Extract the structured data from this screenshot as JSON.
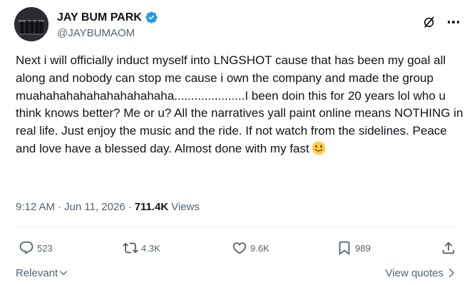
{
  "author": {
    "display_name": "JAY BUM PARK",
    "handle": "@JAYBUMAOM",
    "verified": true
  },
  "header": {
    "icons": [
      "grok-icon",
      "more-icon"
    ]
  },
  "tweet": {
    "text": "Next i will officially induct myself into LNGSHOT cause that has been my goal all along and nobody can stop me cause i own the company and made the group muahahahahahahahahahaha.....................I been doin this for 20 years lol who u think knows better? Me or u? All the narratives yall paint online means NOTHING in real life. Just enjoy the music and the ride. If not watch from the sidelines. Peace and love have a blessed day. Almost done with my fast",
    "emoji": "slightly-smiling-face"
  },
  "meta": {
    "time": "9:12 AM",
    "separator": "·",
    "date": "Jun 11, 2026",
    "views_count": "711.4K",
    "views_label": "Views"
  },
  "actions": {
    "replies": "523",
    "reposts": "4.3K",
    "likes": "9.6K",
    "bookmarks": "989"
  },
  "footer": {
    "sort_label": "Relevant",
    "view_quotes_label": "View quotes"
  },
  "colors": {
    "text_primary": "#0f1419",
    "text_secondary": "#536471",
    "verified_blue": "#1d9bf0",
    "divider": "#eff3f4"
  }
}
